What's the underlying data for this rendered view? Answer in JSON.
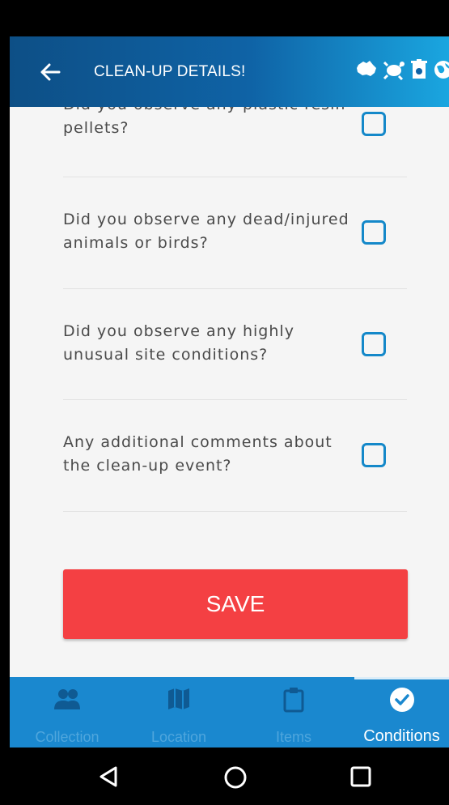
{
  "app_bar": {
    "title": "CLEAN-UP DETAILS!",
    "back_icon": "arrow-left-icon",
    "brand_icons": [
      "australia-icon",
      "turtle-icon",
      "bin-icon",
      "globe-icon"
    ]
  },
  "questions": [
    {
      "text": "Did you observe any plastic resin pellets?",
      "checked": false
    },
    {
      "text": "Did you observe any dead/injured animals or birds?",
      "checked": false
    },
    {
      "text": "Did you observe any highly unusual site conditions?",
      "checked": false
    },
    {
      "text": "Any additional comments about the clean-up event?",
      "checked": false
    }
  ],
  "save_label": "SAVE",
  "bottom_nav": {
    "tabs": [
      {
        "label": "Collection",
        "icon": "people-icon",
        "active": false
      },
      {
        "label": "Location",
        "icon": "map-icon",
        "active": false
      },
      {
        "label": "Items",
        "icon": "clipboard-icon",
        "active": false
      },
      {
        "label": "Conditions",
        "icon": "check-circle-icon",
        "active": true
      }
    ]
  },
  "system_nav": [
    "back-triangle-icon",
    "home-circle-icon",
    "recents-square-icon"
  ],
  "colors": {
    "primary": "#0f63a6",
    "accent": "#1488c9",
    "save": "#f44043",
    "nav_bg": "#1a88cf"
  }
}
